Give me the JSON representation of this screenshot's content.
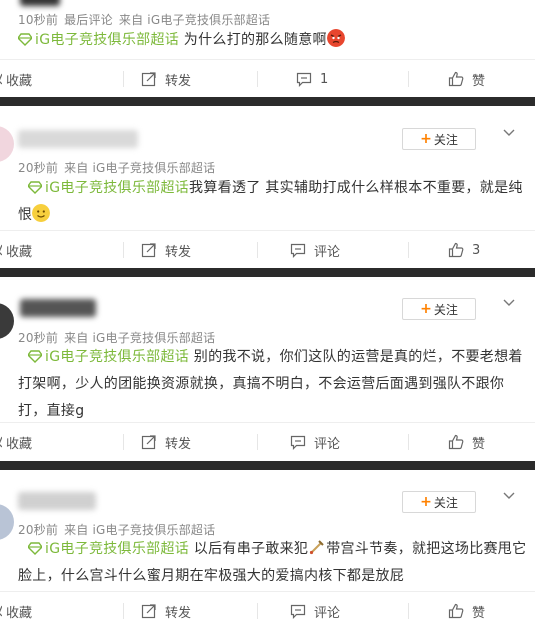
{
  "posts": [
    {
      "meta": {
        "time": "10秒前",
        "extra": "最后评论",
        "source": "来自 iG电子竞技俱乐部超话"
      },
      "topic": "iG电子竞技俱乐部超话",
      "text": " 为什么打的那么随意啊",
      "emoji": "angry-face",
      "actions": {
        "fav": "收藏",
        "repost": "转发",
        "comment": "1",
        "like": "赞"
      }
    },
    {
      "meta": {
        "time": "20秒前",
        "source": "来自 iG电子竞技俱乐部超话"
      },
      "follow": "关注",
      "topic": "iG电子竞技俱乐部超话",
      "text_line1": "我算看透了 其实辅助打成什么样根本不重要，就是纯",
      "text_line2": "恨",
      "emoji": "smiling-face",
      "actions": {
        "fav": "收藏",
        "repost": "转发",
        "comment": "评论",
        "like": "3"
      }
    },
    {
      "meta": {
        "time": "20秒前",
        "source": "来自 iG电子竞技俱乐部超话"
      },
      "follow": "关注",
      "topic": "iG电子竞技俱乐部超话",
      "text_line1": " 别的我不说，你们这队的运营是真的烂，不要老想着",
      "text_line2": "打架啊，少人的团能换资源就换，真搞不明白，不会运营后面遇到强队不跟你",
      "text_line3": "打，直接g",
      "actions": {
        "fav": "收藏",
        "repost": "转发",
        "comment": "评论",
        "like": "赞"
      }
    },
    {
      "meta": {
        "time": "20秒前",
        "source": "来自 iG电子竞技俱乐部超话"
      },
      "follow": "关注",
      "topic": "iG电子竞技俱乐部超话",
      "text_line1a": " 以后有串子敢来犯",
      "emoji": "sword",
      "text_line1b": "带宫斗节奏，就把这场比赛甩它",
      "text_line2": "脸上，什么宫斗什么蜜月期在牢极强大的爱搞内核下都是放屁",
      "actions": {
        "fav": "收藏",
        "repost": "转发",
        "comment": "评论",
        "like": "赞"
      }
    }
  ],
  "colors": {
    "topic": "#7db93b",
    "follow_plus": "#ff8200",
    "divider": "#2b2b2b"
  }
}
